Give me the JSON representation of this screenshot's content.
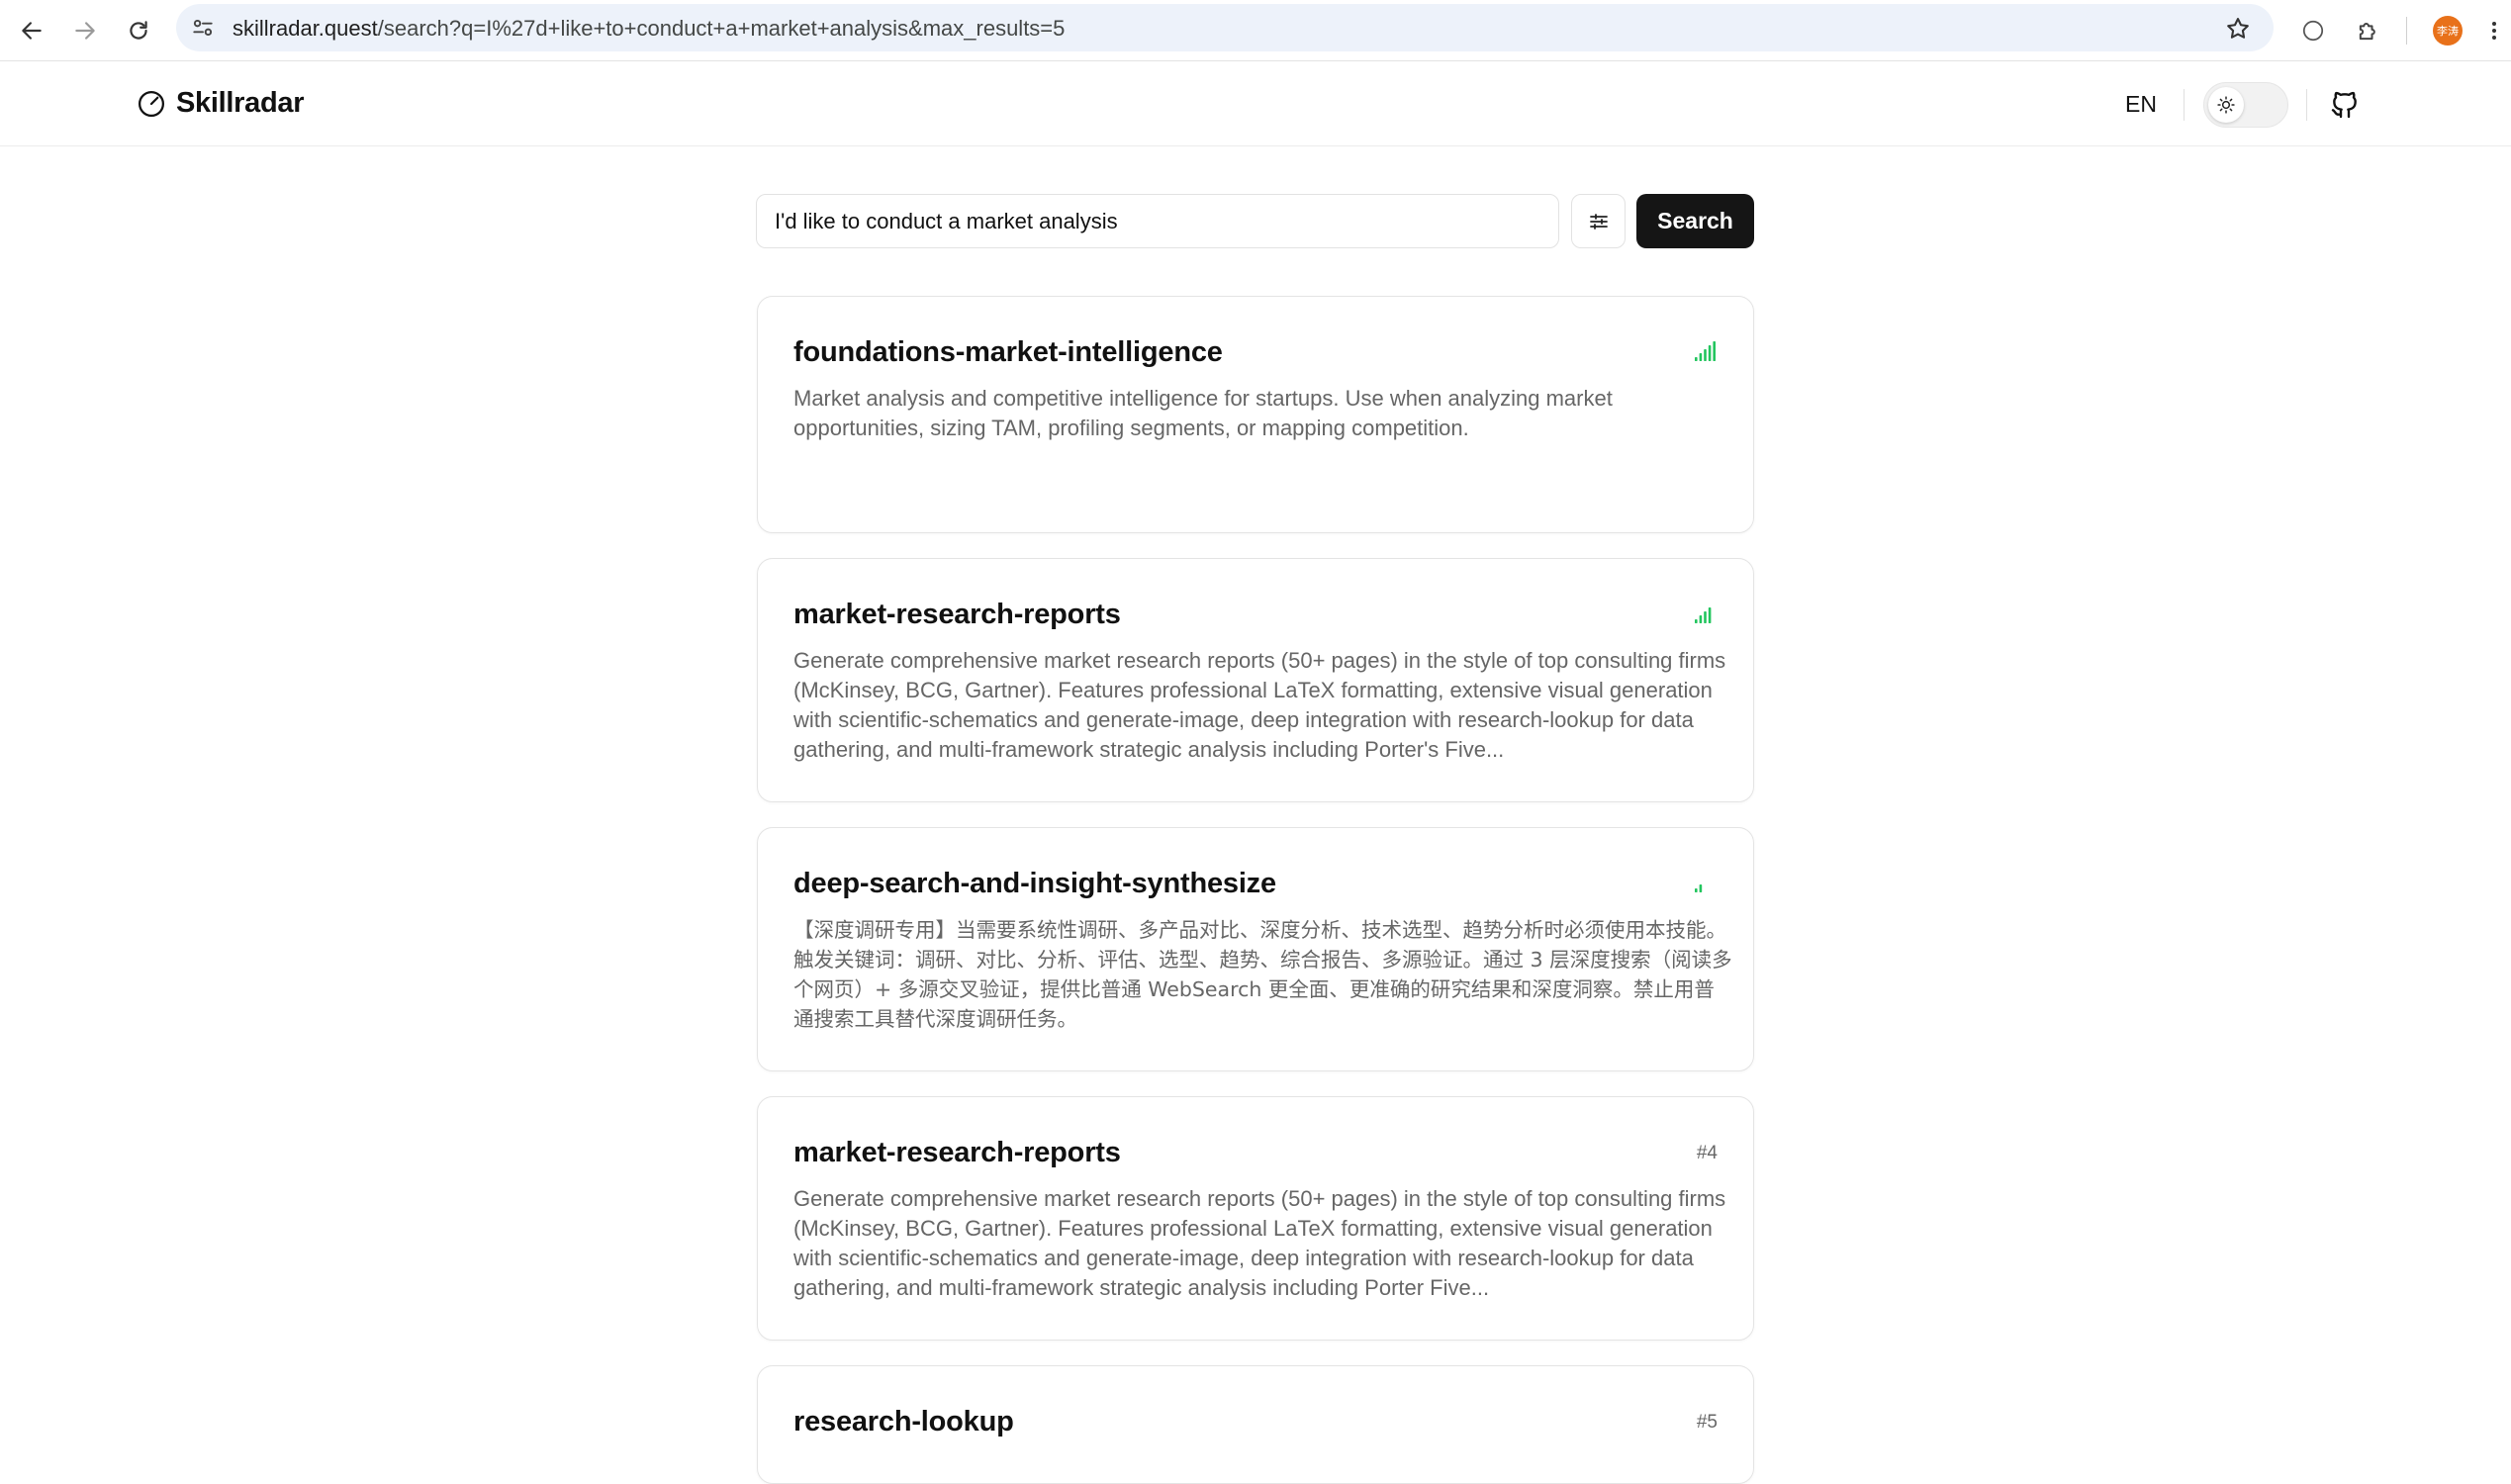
{
  "browser": {
    "url_host": "skillradar.quest",
    "url_path": "/search?q=I%27d+like+to+conduct+a+market+analysis&max_results=5",
    "avatar_text": "李涛"
  },
  "site": {
    "logo_text": "Skillradar",
    "language": "EN"
  },
  "search": {
    "query": "I'd like to conduct a market analysis",
    "button_label": "Search"
  },
  "results": [
    {
      "title": "foundations-market-intelligence",
      "description": "Market analysis and competitive intelligence for startups. Use when analyzing market opportunities, sizing TAM, profiling segments, or mapping competition.",
      "relevance_bars": 5
    },
    {
      "title": "market-research-reports",
      "description": "Generate comprehensive market research reports (50+ pages) in the style of top consulting firms (McKinsey, BCG, Gartner). Features professional LaTeX formatting, extensive visual generation with scientific-schematics and generate-image, deep integration with research-lookup for data gathering, and multi-framework strategic analysis including Porter's Five...",
      "relevance_bars": 4
    },
    {
      "title": "deep-search-and-insight-synthesize",
      "description": "【深度调研专用】当需要系统性调研、多产品对比、深度分析、技术选型、趋势分析时必须使用本技能。触发关键词：调研、对比、分析、评估、选型、趋势、综合报告、多源验证。通过 3 层深度搜索（阅读多个网页）+ 多源交叉验证，提供比普通 WebSearch 更全面、更准确的研究结果和深度洞察。禁止用普通搜索工具替代深度调研任务。",
      "relevance_bars": 2
    },
    {
      "title": "market-research-reports",
      "description": "Generate comprehensive market research reports (50+ pages) in the style of top consulting firms (McKinsey, BCG, Gartner). Features professional LaTeX formatting, extensive visual generation with scientific-schematics and generate-image, deep integration with research-lookup for data gathering, and multi-framework strategic analysis including Porter Five...",
      "rank": "#4"
    },
    {
      "title": "research-lookup",
      "description": "",
      "rank": "#5"
    }
  ],
  "colors": {
    "signal_green": "#22c55e",
    "signal_light": "#bbf7d0",
    "button_dark": "#151515"
  }
}
